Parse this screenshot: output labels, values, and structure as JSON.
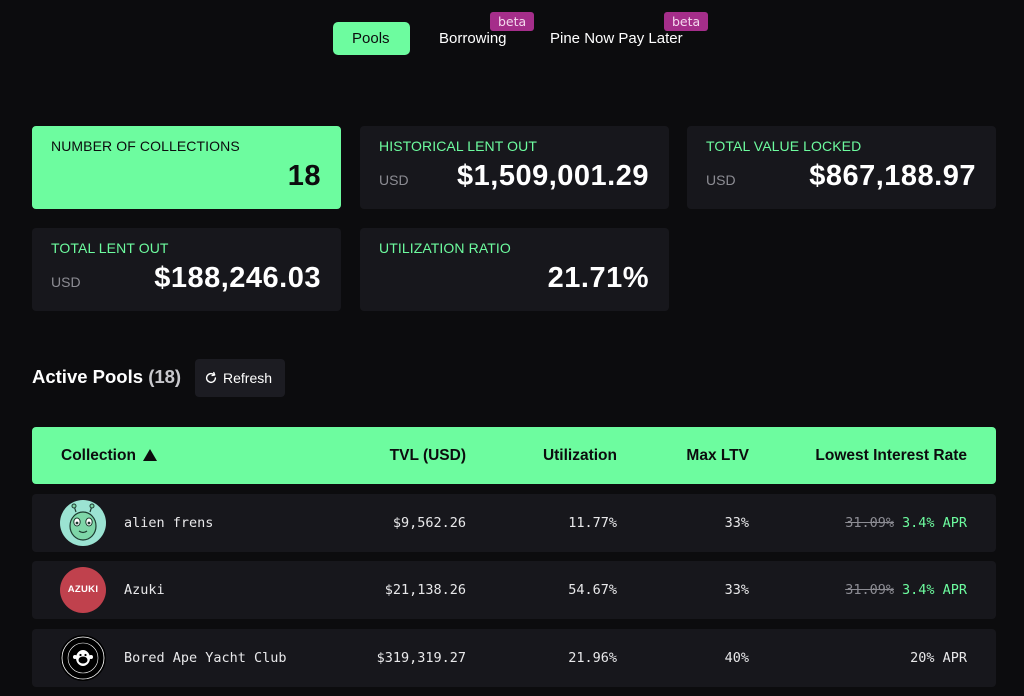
{
  "nav": {
    "tabs": [
      {
        "label": "Pools",
        "active": true
      },
      {
        "label": "Borrowing",
        "badge": "beta"
      },
      {
        "label": "Pine Now Pay Later",
        "badge": "beta"
      }
    ]
  },
  "stats": {
    "collections": {
      "label": "NUMBER OF COLLECTIONS",
      "value": "18"
    },
    "historical": {
      "label": "HISTORICAL LENT OUT",
      "unit": "USD",
      "value": "$1,509,001.29"
    },
    "tvl": {
      "label": "TOTAL VALUE LOCKED",
      "unit": "USD",
      "value": "$867,188.97"
    },
    "lent": {
      "label": "TOTAL LENT OUT",
      "unit": "USD",
      "value": "$188,246.03"
    },
    "utilization": {
      "label": "UTILIZATION RATIO",
      "value": "21.71%"
    }
  },
  "pools": {
    "title": "Active Pools",
    "count": "(18)",
    "refresh_label": "Refresh",
    "columns": [
      "Collection",
      "TVL (USD)",
      "Utilization",
      "Max LTV",
      "Lowest Interest Rate"
    ],
    "rows": [
      {
        "name": "alien frens",
        "tvl": "$9,562.26",
        "utilization": "11.77%",
        "max_ltv": "33%",
        "old_rate": "31.09%",
        "rate": "3.4% APR",
        "avatar": "alien-frens-avatar"
      },
      {
        "name": "Azuki",
        "tvl": "$21,138.26",
        "utilization": "54.67%",
        "max_ltv": "33%",
        "old_rate": "31.09%",
        "rate": "3.4% APR",
        "avatar": "azuki-avatar",
        "avatar_text": "AZUKI"
      },
      {
        "name": "Bored Ape Yacht Club",
        "tvl": "$319,319.27",
        "utilization": "21.96%",
        "max_ltv": "40%",
        "rate": "20% APR",
        "avatar": "bayc-avatar"
      }
    ]
  },
  "colors": {
    "accent": "#6dfc9f",
    "card": "#17171c",
    "background": "#0c0c0e",
    "beta": "#a52e8a"
  }
}
